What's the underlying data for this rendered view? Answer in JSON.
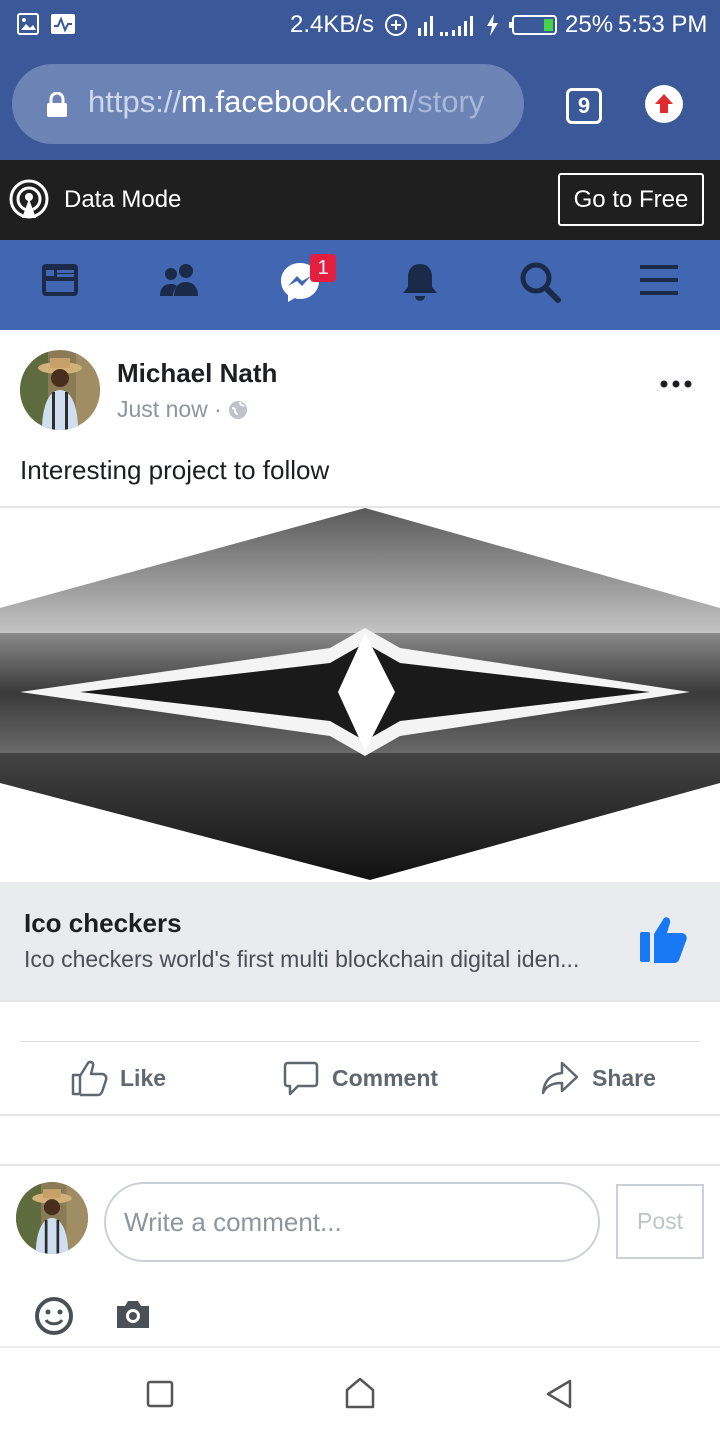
{
  "status_bar": {
    "speed": "2.4KB/s",
    "battery": "25%",
    "time": "5:53 PM"
  },
  "browser": {
    "url_scheme": "https://",
    "url_host": "m.facebook.com",
    "url_tail": "/story",
    "tab_count": "9"
  },
  "data_mode": {
    "label": "Data Mode",
    "go_free": "Go to Free"
  },
  "nav": {
    "messages_badge": "1"
  },
  "post": {
    "author": "Michael Nath",
    "time": "Just now",
    "separator": "·",
    "text": "Interesting project to follow",
    "link_title": "Ico checkers",
    "link_description": "Ico checkers world's first multi blockchain digital iden..."
  },
  "actions": {
    "like": "Like",
    "comment": "Comment",
    "share": "Share"
  },
  "comment": {
    "placeholder": "Write a comment...",
    "post_label": "Post"
  },
  "colors": {
    "brand_blue": "#3b5998",
    "nav_blue": "#4267b2",
    "like_blue": "#1877f2",
    "badge_red": "#e41e3f"
  }
}
